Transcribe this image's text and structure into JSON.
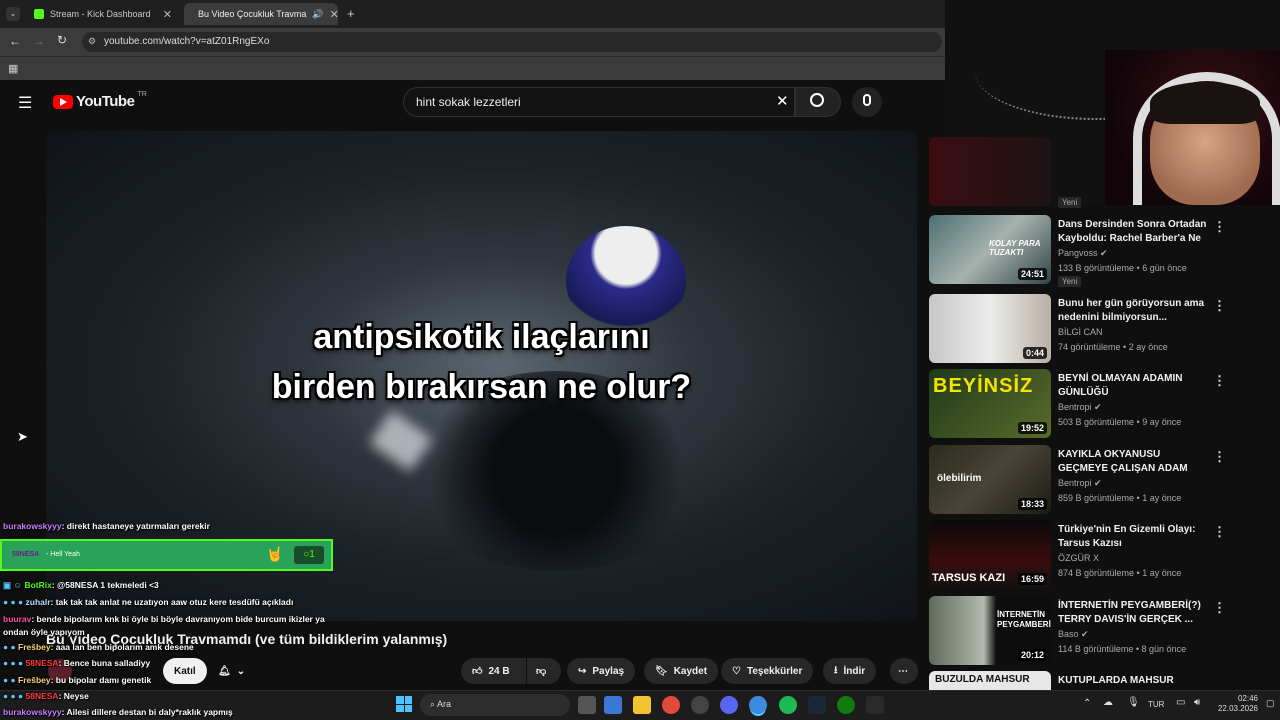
{
  "browser": {
    "tabs": [
      {
        "label": "Stream - Kick Dashboard"
      },
      {
        "label": "Bu Video Çocukluk Travma"
      }
    ],
    "url": "youtube.com/watch?v=atZ01RngEXo"
  },
  "youtube": {
    "logo": "YouTube",
    "region": "TR",
    "search_query": "hint sokak lezzetleri"
  },
  "video": {
    "subtitle_line1": "antipsikotik ilaçlarını",
    "subtitle_line2": "birden bırakırsan ne olur?",
    "title": "Bu Video Çocukluk Travmamdı (ve tüm bildiklerim yalanmış)"
  },
  "actions": {
    "join": "Katıl",
    "likes": "24 B",
    "share": "Paylaş",
    "save": "Kaydet",
    "thanks": "Teşekkürler",
    "download": "İndir"
  },
  "recommendations": [
    {
      "badge": "Yeni"
    },
    {
      "title": "Dans Dersinden Sonra Ortadan Kayboldu: Rachel Barber'a Ne ...",
      "channel": "Pangvoss",
      "meta": "133 B görüntüleme • 6 gün önce",
      "duration": "24:51",
      "badge": "Yeni",
      "thumb_text": "KOLAY PARA TUZAKTI"
    },
    {
      "title": "Bunu her gün görüyorsun ama nedenini bilmiyorsun...",
      "channel": "BİLGİ CAN",
      "meta": "74 görüntüleme • 2 ay önce",
      "duration": "0:44"
    },
    {
      "title": "BEYNİ OLMAYAN ADAMIN GÜNLÜĞÜ",
      "channel": "Bentropi",
      "meta": "503 B görüntüleme • 9 ay önce",
      "duration": "19:52",
      "thumb_text": "BEYİNSİZ"
    },
    {
      "title": "KAYIKLA OKYANUSU GEÇMEYE ÇALIŞAN ADAM",
      "channel": "Bentropi",
      "meta": "859 B görüntüleme • 1 ay önce",
      "duration": "18:33",
      "thumb_text": "ölebilirim"
    },
    {
      "title": "Türkiye'nin En Gizemli Olayı: Tarsus Kazısı",
      "channel": "ÖZGÜR X",
      "meta": "874 B görüntüleme • 1 ay önce",
      "duration": "16:59",
      "thumb_text": "TARSUS KAZI"
    },
    {
      "title": "İNTERNETİN PEYGAMBERİ(?) TERRY DAVIS'İN GERÇEK ...",
      "channel": "Baso",
      "meta": "114 B görüntüleme • 8 gün önce",
      "duration": "20:12",
      "thumb_text": "İNTERNETİN PEYGAMBERİ"
    },
    {
      "title": "KUTUPLARDA MAHSUR",
      "thumb_text": "BUZULDA MAHSUR"
    }
  ],
  "chat": {
    "notification": {
      "user": "58NESA",
      "text": "- Hell Yeah",
      "count": "1"
    },
    "messages": [
      {
        "user": "burakowskyyy",
        "text": ": direkt hastaneye yatırmaları gerekir"
      },
      {
        "user": "BotRix",
        "text": ": @58NESA 1 tekmeledi <3"
      },
      {
        "user": "zuhalr",
        "text": ": tak tak tak anlat ne uzatıyon aaw otuz kere tesdüfü açıkladı"
      },
      {
        "user": "buurav",
        "text": ": bende bipolarım knk bi öyle bi böyle davranıyom bide burcum ikizler ya ondan öyle yapıyom"
      },
      {
        "user": "Frešbey",
        "text": ": aaa lan ben bipolarım amk desene"
      },
      {
        "user": "58NESA",
        "text": ": Bence buna salladiyy"
      },
      {
        "user": "Frešbey",
        "text": ": bu bipolar damı genetik"
      },
      {
        "user": "58NESA",
        "text": ": Neyse"
      },
      {
        "user": "burakowskyyy",
        "text": ": Ailesi dillere destan bi daly*raklık yapmış"
      }
    ]
  },
  "taskbar": {
    "search": "Ara",
    "lang": "TUR",
    "time": "02:46",
    "date": "22.03.2026"
  }
}
